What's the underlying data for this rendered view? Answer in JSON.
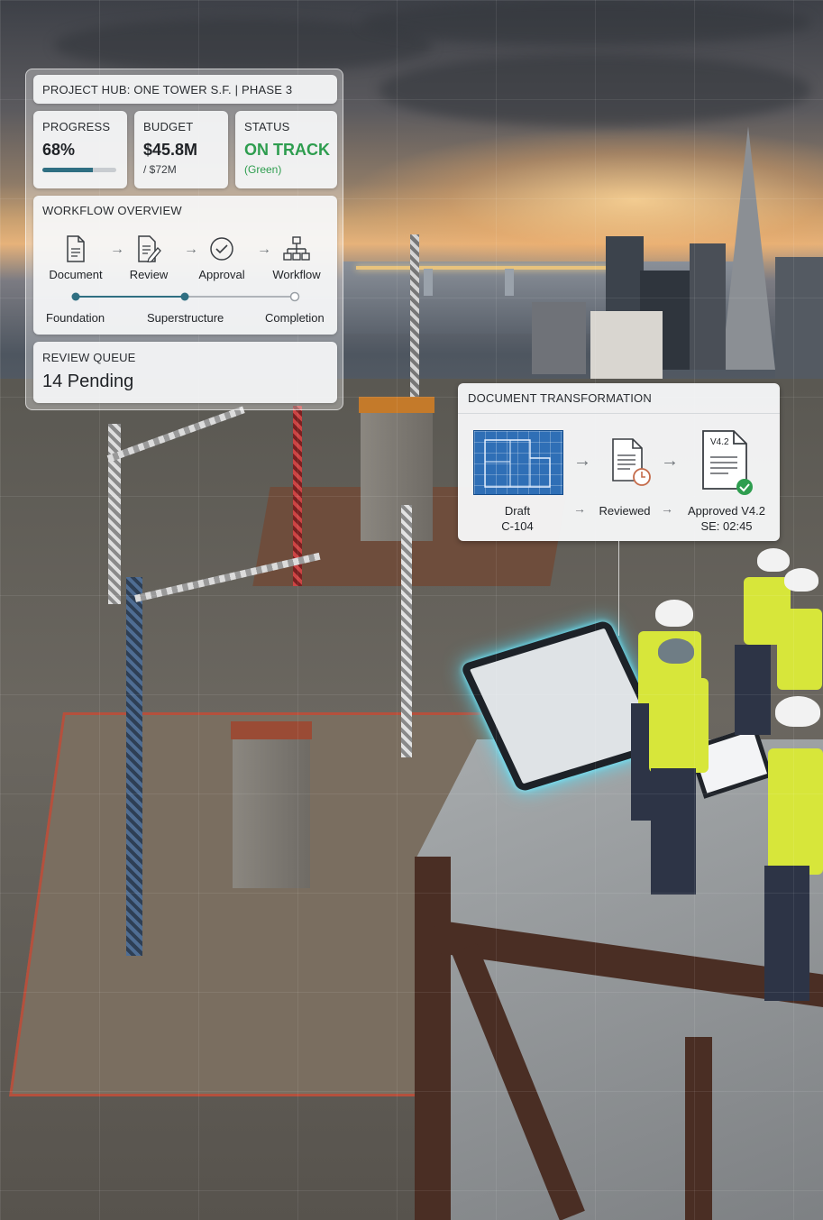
{
  "hub": {
    "title": "PROJECT HUB: ONE TOWER S.F. | PHASE 3",
    "progress": {
      "label": "PROGRESS",
      "value": "68%",
      "fraction": 0.68
    },
    "budget": {
      "label": "BUDGET",
      "value": "$45.8M",
      "total": "/ $72M"
    },
    "status": {
      "label": "STATUS",
      "value": "ON TRACK",
      "note": "(Green)",
      "color": "#2e9d4f"
    },
    "workflow": {
      "heading": "WORKFLOW OVERVIEW",
      "steps": [
        {
          "label": "Document",
          "icon": "document-icon"
        },
        {
          "label": "Review",
          "icon": "review-edit-icon"
        },
        {
          "label": "Approval",
          "icon": "check-circle-icon"
        },
        {
          "label": "Workflow",
          "icon": "org-chart-icon"
        }
      ],
      "phases": [
        "Foundation",
        "Superstructure",
        "Completion"
      ]
    },
    "review_queue": {
      "label": "REVIEW QUEUE",
      "value": "14 Pending"
    }
  },
  "doc_transform": {
    "heading": "DOCUMENT TRANSFORMATION",
    "draft": {
      "label": "Draft",
      "code": "C-104"
    },
    "reviewed": {
      "label": "Reviewed"
    },
    "approved": {
      "label": "Approved V4.2",
      "meta": "SE: 02:45",
      "badge": "V4.2"
    }
  },
  "colors": {
    "accent": "#2f6f82",
    "status_green": "#2e9d4f"
  }
}
